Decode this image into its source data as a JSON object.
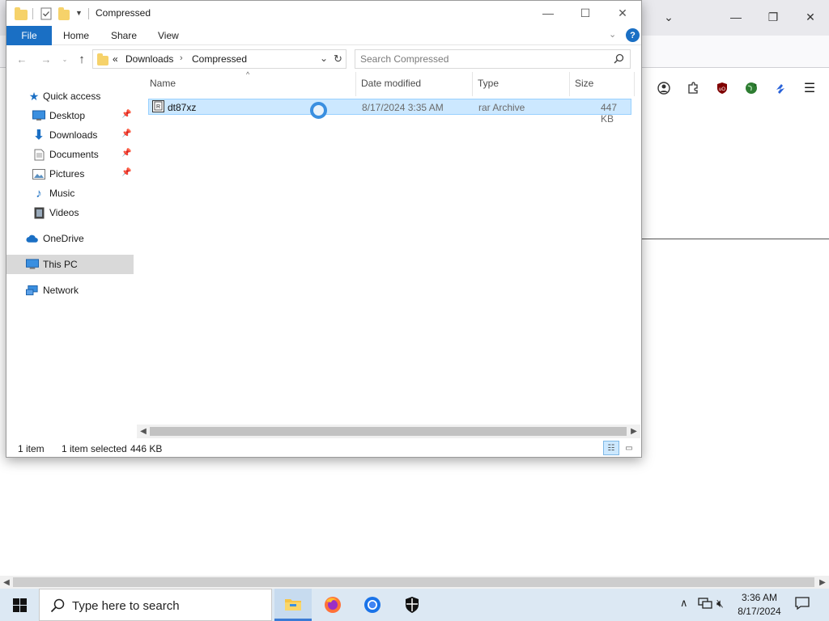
{
  "browser": {
    "ext_icons": [
      "account-icon",
      "extensions-icon",
      "ublock-icon",
      "green-globe-extension-icon",
      "blue-extension-icon",
      "hamburger-menu-icon"
    ]
  },
  "explorer": {
    "title": "Compressed",
    "ribbon_tabs": [
      "File",
      "Home",
      "Share",
      "View"
    ],
    "address": {
      "overflow": "«",
      "segments": [
        "Downloads",
        "Compressed"
      ]
    },
    "search_placeholder": "Search Compressed",
    "nav": {
      "quick_access": "Quick access",
      "items": [
        "Desktop",
        "Downloads",
        "Documents",
        "Pictures",
        "Music",
        "Videos"
      ],
      "onedrive": "OneDrive",
      "this_pc": "This PC",
      "network": "Network"
    },
    "columns": {
      "name": "Name",
      "date": "Date modified",
      "type": "Type",
      "size": "Size"
    },
    "files": [
      {
        "name": "dt87xz",
        "date": "8/17/2024 3:35 AM",
        "type": "rar Archive",
        "size": "447 KB"
      }
    ],
    "status": {
      "count": "1 item",
      "selected": "1 item selected",
      "size": "446 KB"
    }
  },
  "taskbar": {
    "search_placeholder": "Type here to search",
    "time": "3:36 AM",
    "date": "8/17/2024"
  }
}
